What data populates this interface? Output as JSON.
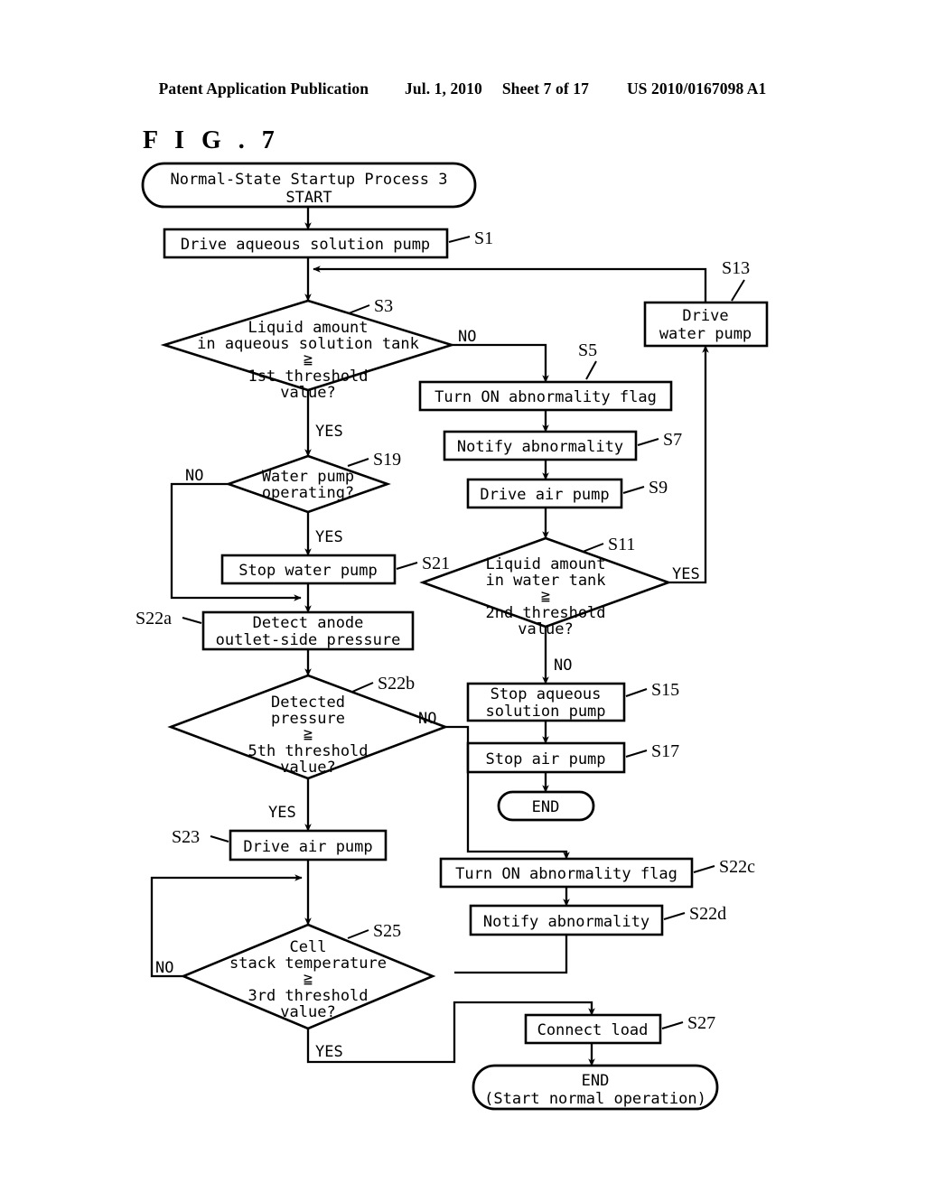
{
  "header": {
    "publication": "Patent Application Publication",
    "date": "Jul. 1, 2010",
    "sheet": "Sheet 7 of 17",
    "docnum": "US 2010/0167098 A1"
  },
  "figure": {
    "label": "F I G .  7"
  },
  "nodes": {
    "start": {
      "line1": "Normal-State Startup Process 3",
      "line2": "START"
    },
    "s1": {
      "text": "Drive aqueous solution pump",
      "step": "S1"
    },
    "s3": {
      "l1": "Liquid amount",
      "l2": "in aqueous solution tank",
      "l3": "≧",
      "l4": "1st threshold",
      "l5": "value?",
      "step": "S3"
    },
    "s5": {
      "text": "Turn ON abnormality flag",
      "step": "S5"
    },
    "s7": {
      "text": "Notify abnormality",
      "step": "S7"
    },
    "s9": {
      "text": "Drive air pump",
      "step": "S9"
    },
    "s11": {
      "l1": "Liquid amount",
      "l2": "in water tank",
      "l3": "≧",
      "l4": "2nd threshold",
      "l5": "value?",
      "step": "S11"
    },
    "s13": {
      "l1": "Drive",
      "l2": "water pump",
      "step": "S13"
    },
    "s15": {
      "l1": "Stop aqueous",
      "l2": "solution pump",
      "step": "S15"
    },
    "s17": {
      "text": "Stop air pump",
      "step": "S17"
    },
    "end1": {
      "text": "END"
    },
    "s19": {
      "l1": "Water pump",
      "l2": "operating?",
      "step": "S19"
    },
    "s21": {
      "text": "Stop water pump",
      "step": "S21"
    },
    "s22a": {
      "l1": "Detect anode",
      "l2": "outlet-side pressure",
      "step": "S22a"
    },
    "s22b": {
      "l1": "Detected",
      "l2": "pressure",
      "l3": "≧",
      "l4": "5th threshold",
      "l5": "value?",
      "step": "S22b"
    },
    "s22c": {
      "text": "Turn ON abnormality flag",
      "step": "S22c"
    },
    "s22d": {
      "text": "Notify abnormality",
      "step": "S22d"
    },
    "s23": {
      "text": "Drive air pump",
      "step": "S23"
    },
    "s25": {
      "l1": "Cell",
      "l2": "stack temperature",
      "l3": "≧",
      "l4": "3rd threshold",
      "l5": "value?",
      "step": "S25"
    },
    "s27": {
      "text": "Connect load",
      "step": "S27"
    },
    "end2": {
      "l1": "END",
      "l2": "(Start normal operation)"
    }
  },
  "branches": {
    "s3_no": "NO",
    "s3_yes": "YES",
    "s19_no": "NO",
    "s19_yes": "YES",
    "s11_yes": "YES",
    "s11_no": "NO",
    "s22b_no": "NO",
    "s22b_yes": "YES",
    "s25_no": "NO",
    "s25_yes": "YES"
  },
  "colors": {
    "ink": "#000000",
    "paper": "#ffffff"
  }
}
